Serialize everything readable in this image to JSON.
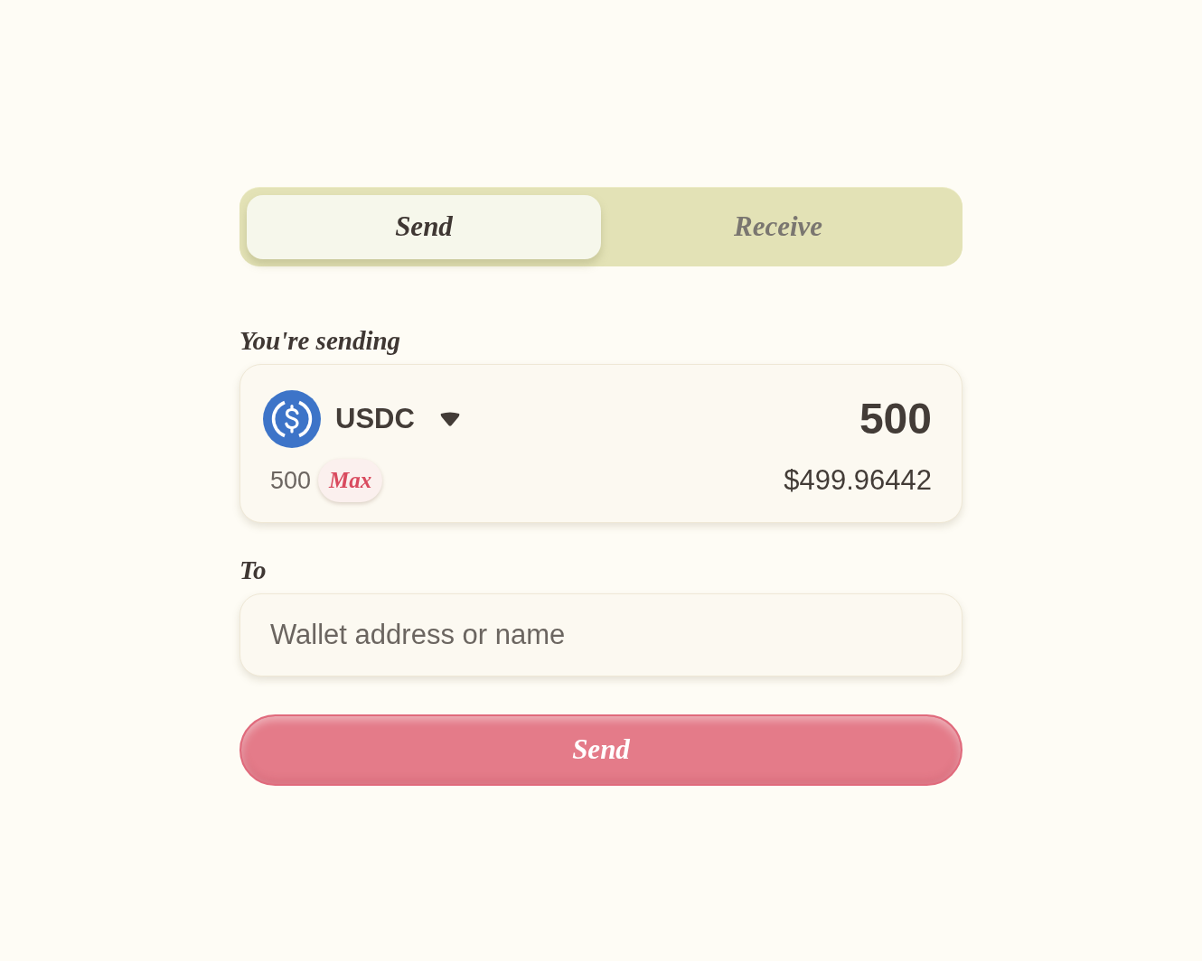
{
  "tabs": [
    {
      "label": "Send",
      "selected": true
    },
    {
      "label": "Receive",
      "selected": false
    }
  ],
  "amount_section": {
    "label": "You're sending",
    "token": {
      "symbol": "USDC"
    },
    "amount": "500",
    "balance": "500",
    "max_button": "Max",
    "usd_value": "$499.96442"
  },
  "recipient": {
    "label": "To",
    "placeholder": "Wallet address or name"
  },
  "submit_button": "Send"
}
